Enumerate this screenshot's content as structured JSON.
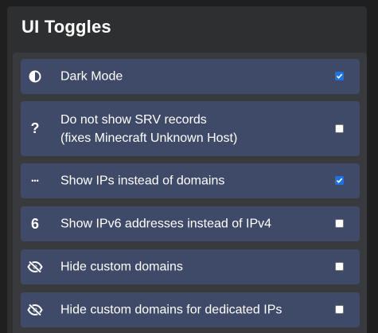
{
  "panel": {
    "title": "UI Toggles"
  },
  "toggles": [
    {
      "icon": "half-circle-icon",
      "label": "Dark Mode",
      "label2": "",
      "checked": true
    },
    {
      "icon": "question-mark-icon",
      "glyph": "?",
      "label": "Do not show SRV records",
      "label2": "(fixes Minecraft Unknown Host)",
      "checked": false
    },
    {
      "icon": "ellipsis-icon",
      "glyph": "•••",
      "label": "Show IPs instead of domains",
      "label2": "",
      "checked": true
    },
    {
      "icon": "six-icon",
      "glyph": "6",
      "label": "Show IPv6 addresses instead of IPv4",
      "label2": "",
      "checked": false
    },
    {
      "icon": "eye-slash-icon",
      "label": "Hide custom domains",
      "label2": "",
      "checked": false
    },
    {
      "icon": "eye-slash-icon",
      "label": "Hide custom domains for dedicated IPs",
      "label2": "",
      "checked": false
    }
  ]
}
